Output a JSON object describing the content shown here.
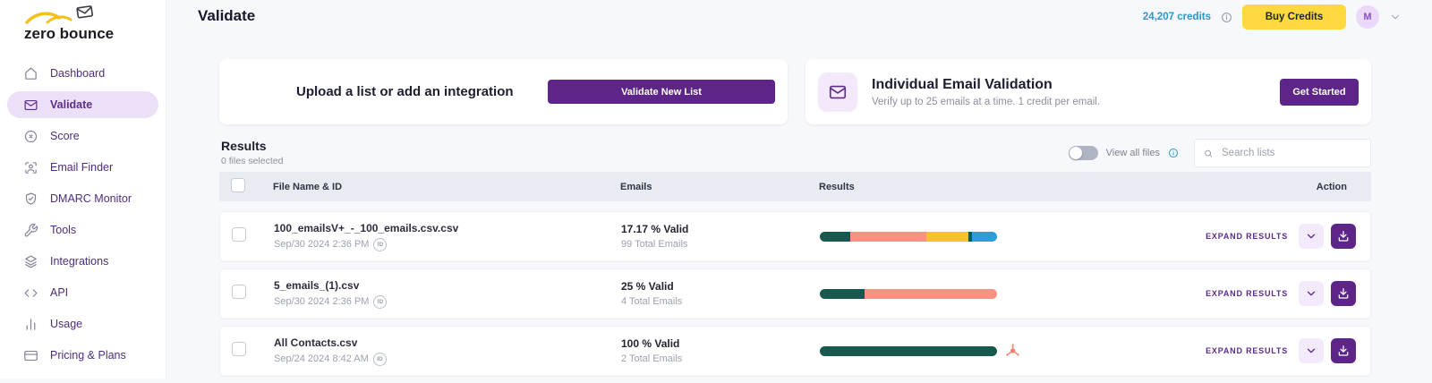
{
  "brand": {
    "logo_text": "zero bounce"
  },
  "sidebar": {
    "active_item": "Validate",
    "items": [
      {
        "label": "Dashboard",
        "icon": "home-icon"
      },
      {
        "label": "Validate",
        "icon": "envelope-icon"
      },
      {
        "label": "Score",
        "icon": "gauge-icon"
      },
      {
        "label": "Email Finder",
        "icon": "person-search-icon"
      },
      {
        "label": "DMARC Monitor",
        "icon": "shield-check-icon"
      },
      {
        "label": "Tools",
        "icon": "wrench-icon"
      },
      {
        "label": "Integrations",
        "icon": "layers-icon"
      },
      {
        "label": "API",
        "icon": "code-icon"
      },
      {
        "label": "Usage",
        "icon": "bar-chart-icon"
      },
      {
        "label": "Pricing & Plans",
        "icon": "credit-card-icon"
      }
    ]
  },
  "header": {
    "title": "Validate",
    "credits": "24,207 credits",
    "buy_credits_label": "Buy Credits",
    "avatar_initial": "M"
  },
  "upload_card": {
    "text": "Upload a list or add an integration",
    "button_label": "Validate New List"
  },
  "individual_card": {
    "title": "Individual Email Validation",
    "subtitle": "Verify up to 25 emails at a time. 1 credit per email.",
    "button_label": "Get Started"
  },
  "results_section": {
    "title": "Results",
    "selected_text": "0 files selected",
    "view_all_label": "View all files",
    "search_placeholder": "Search lists"
  },
  "table": {
    "headers": [
      "File Name & ID",
      "Emails",
      "Results",
      "Action"
    ],
    "expand_label": "EXPAND RESULTS",
    "id_badge_label": "ID",
    "rows": [
      {
        "file_name": "100_emailsV+_-_100_emails.csv.csv",
        "date": "Sep/30 2024 2:36 PM",
        "valid_pct": "17.17 % Valid",
        "total": "99 Total Emails",
        "segments": [
          {
            "color": "teal",
            "pct": 17
          },
          {
            "color": "salmon",
            "pct": 43
          },
          {
            "color": "yellow",
            "pct": 24
          },
          {
            "color": "teal",
            "pct": 2
          },
          {
            "color": "blue",
            "pct": 14
          }
        ],
        "integration_icon": null
      },
      {
        "file_name": "5_emails_(1).csv",
        "date": "Sep/30 2024 2:36 PM",
        "valid_pct": "25 % Valid",
        "total": "4 Total Emails",
        "segments": [
          {
            "color": "teal",
            "pct": 25
          },
          {
            "color": "salmon",
            "pct": 75
          }
        ],
        "integration_icon": null
      },
      {
        "file_name": "All Contacts.csv",
        "date": "Sep/24 2024 8:42 AM",
        "valid_pct": "100 % Valid",
        "total": "2 Total Emails",
        "segments": [
          {
            "color": "teal",
            "pct": 100
          }
        ],
        "integration_icon": "hubspot-icon"
      }
    ]
  },
  "colors": {
    "teal": "#17594f",
    "salmon": "#fb9180",
    "yellow": "#f8c32a",
    "blue": "#2e9cd6",
    "purple": "#5e2589",
    "purple_light": "#ece0f9",
    "yellow_button": "#fdd93f",
    "credits_blue": "#2996cc",
    "hubspot_orange": "#f87f6e"
  }
}
